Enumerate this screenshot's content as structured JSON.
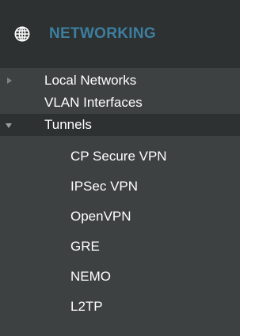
{
  "header": {
    "title": "NETWORKING",
    "icon": "globe-icon"
  },
  "menu": {
    "items": [
      {
        "label": "Local Networks",
        "expanded": false
      },
      {
        "label": "VLAN Interfaces"
      },
      {
        "label": "Tunnels",
        "expanded": true
      }
    ],
    "tunnels": [
      {
        "label": "CP Secure VPN"
      },
      {
        "label": "IPSec VPN"
      },
      {
        "label": "OpenVPN"
      },
      {
        "label": "GRE"
      },
      {
        "label": "NEMO"
      },
      {
        "label": "L2TP"
      }
    ]
  },
  "colors": {
    "panel": "#3d4142",
    "header": "#2d3131",
    "accent": "#3d7fa0",
    "text": "#ffffff"
  }
}
